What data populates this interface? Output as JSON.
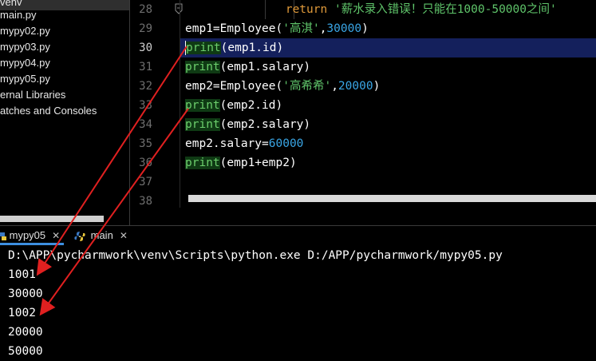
{
  "project_tree": {
    "items": [
      {
        "label": "venv",
        "selected": true
      },
      {
        "label": "main.py"
      },
      {
        "label": "mypy02.py"
      },
      {
        "label": "mypy03.py"
      },
      {
        "label": "mypy04.py"
      },
      {
        "label": "mypy05.py"
      },
      {
        "label": "ernal Libraries"
      },
      {
        "label": "atches and Consoles"
      }
    ]
  },
  "editor": {
    "current_line": "30",
    "line_numbers": [
      "28",
      "29",
      "30",
      "31",
      "32",
      "33",
      "34",
      "35",
      "36",
      "37",
      "38"
    ],
    "lines": [
      {
        "indent": "        ",
        "kw": "return",
        "str": "'薪水录入错误！只能在1000-50000之间'"
      },
      {
        "pre": "emp1=Employee(",
        "str": "'高淇'",
        "mid": ",",
        "num": "30000",
        "post": ")"
      },
      {
        "kw": "print",
        "post": "(emp1.id)"
      },
      {
        "kw": "print",
        "post": "(emp1.salary)"
      },
      {
        "pre": "emp2=Employee(",
        "str": "'高希希'",
        "mid": ",",
        "num": "20000",
        "post": ")"
      },
      {
        "kw": "print",
        "post": "(emp2.id)"
      },
      {
        "kw": "print",
        "post": "(emp2.salary)"
      },
      {
        "pre": "emp2.salary=",
        "num": "60000"
      },
      {
        "kw": "print",
        "post": "(emp1+emp2)"
      }
    ]
  },
  "run": {
    "tabs": [
      {
        "label": "mypy05",
        "active": true
      },
      {
        "label": "main",
        "active": false
      }
    ],
    "output": [
      "D:\\APP\\pycharmwork\\venv\\Scripts\\python.exe D:/APP/pycharmwork/mypy05.py",
      "1001",
      "30000",
      "1002",
      "20000",
      "50000"
    ]
  },
  "colors": {
    "background": "#000000",
    "current_line_bg": "#14205c",
    "print_highlight": "#0f3a14",
    "string": "#5fc46a",
    "number": "#3aa6e6",
    "keyword_return": "#e09a3a",
    "annotation_arrow": "#e02020",
    "active_tab_underline": "#3d8fe0"
  },
  "icons": [
    "python-file-icon",
    "close-icon",
    "fold-icon"
  ]
}
